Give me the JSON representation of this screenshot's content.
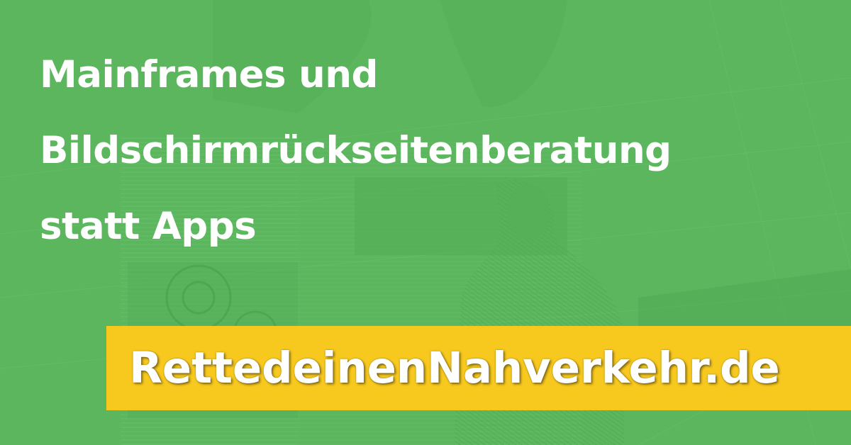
{
  "colors": {
    "background": "#5bb65e",
    "banner": "#f7c81e",
    "text": "#ffffff"
  },
  "background_image": "engraving-illustration",
  "headline": {
    "line1": "Mainframes und",
    "line2": "Bildschirmrückseitenberatung",
    "line3": "statt Apps"
  },
  "banner": {
    "label": "RettedeinenNahverkehr.de"
  }
}
